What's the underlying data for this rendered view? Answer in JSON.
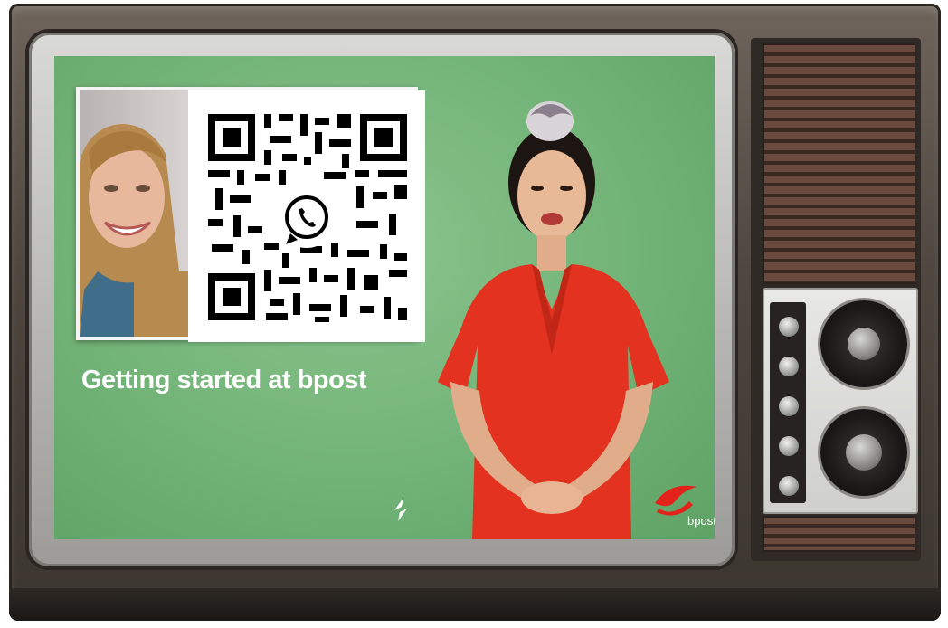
{
  "screen": {
    "title": "Getting started at bpost",
    "brand_text": "bpost",
    "background_color": "#77b77b",
    "brand_color": "#e3221b"
  },
  "icons": {
    "qr": "qr-code-icon",
    "whatsapp": "whatsapp-icon",
    "small_logo": "arrows-logo-icon",
    "bpost": "bpost-horn-logo"
  }
}
